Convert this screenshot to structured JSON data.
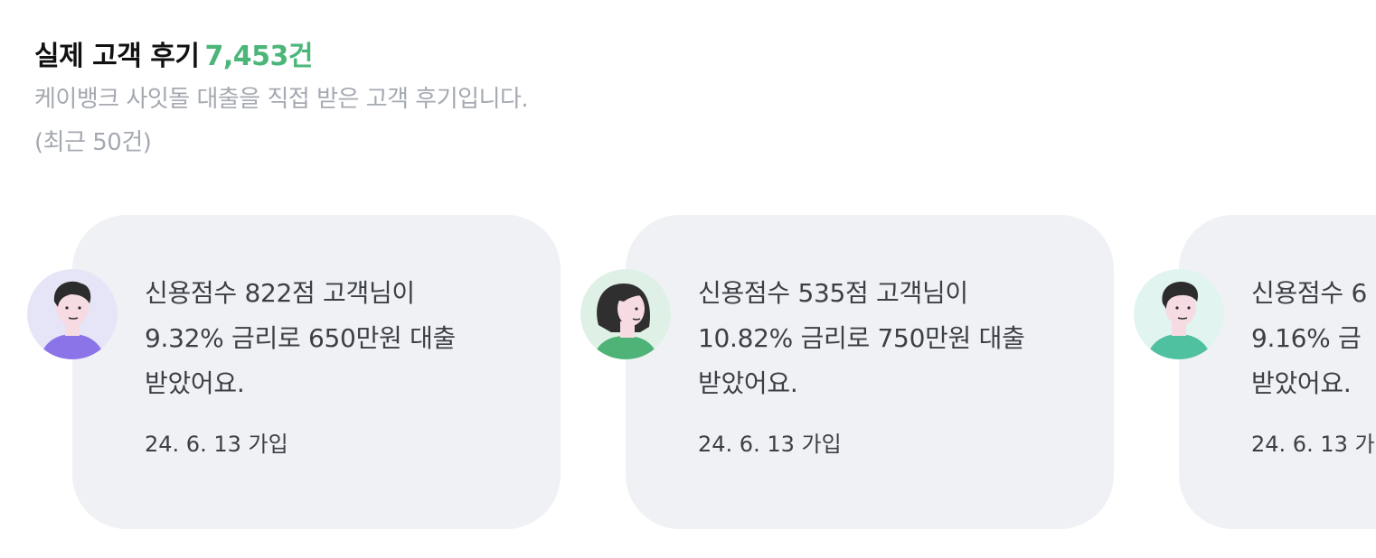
{
  "header": {
    "title": "실제 고객 후기",
    "count": "7,453건",
    "subtitle_line1": "케이뱅크 사잇돌 대출을 직접 받은 고객 후기입니다.",
    "subtitle_line2": "(최근 50건)"
  },
  "colors": {
    "accent": "#4cb67a",
    "card_bg": "#f0f1f5",
    "subtitle": "#a5a9b1"
  },
  "reviews": [
    {
      "line1": "신용점수 822점 고객님이",
      "line2": "9.32% 금리로 650만원 대출",
      "line3": "받았어요.",
      "date": "24. 6. 13 가입",
      "avatar": "man-avatar-purple-shirt-icon"
    },
    {
      "line1": "신용점수 535점 고객님이",
      "line2": "10.82% 금리로 750만원 대출",
      "line3": "받았어요.",
      "date": "24. 6. 13 가입",
      "avatar": "woman-avatar-green-shirt-icon"
    },
    {
      "line1": "신용점수 6",
      "line2": "9.16% 금",
      "line3": "받았어요.",
      "date": "24. 6. 13 가",
      "avatar": "man-avatar-teal-shirt-icon"
    }
  ]
}
